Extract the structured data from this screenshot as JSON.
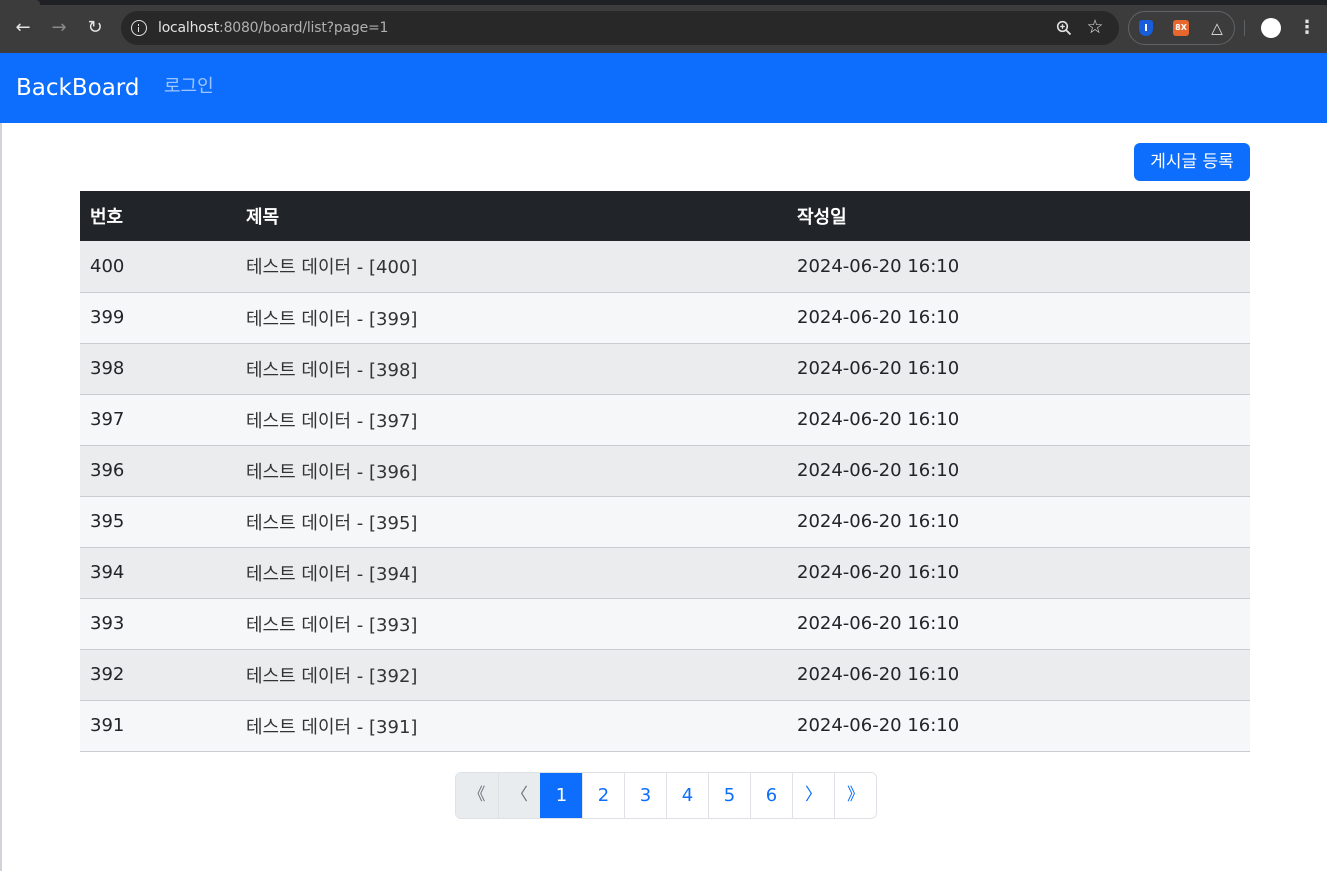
{
  "browser": {
    "url_host": "localhost",
    "url_path": ":8080/board/list?page=1",
    "ext_badge": "8X"
  },
  "navbar": {
    "brand": "BackBoard",
    "login": "로그인"
  },
  "actions": {
    "register_label": "게시글 등록"
  },
  "table": {
    "headers": {
      "num": "번호",
      "title": "제목",
      "date": "작성일"
    },
    "rows": [
      {
        "num": "400",
        "title": "테스트 데이터 - [400]",
        "date": "2024-06-20 16:10"
      },
      {
        "num": "399",
        "title": "테스트 데이터 - [399]",
        "date": "2024-06-20 16:10"
      },
      {
        "num": "398",
        "title": "테스트 데이터 - [398]",
        "date": "2024-06-20 16:10"
      },
      {
        "num": "397",
        "title": "테스트 데이터 - [397]",
        "date": "2024-06-20 16:10"
      },
      {
        "num": "396",
        "title": "테스트 데이터 - [396]",
        "date": "2024-06-20 16:10"
      },
      {
        "num": "395",
        "title": "테스트 데이터 - [395]",
        "date": "2024-06-20 16:10"
      },
      {
        "num": "394",
        "title": "테스트 데이터 - [394]",
        "date": "2024-06-20 16:10"
      },
      {
        "num": "393",
        "title": "테스트 데이터 - [393]",
        "date": "2024-06-20 16:10"
      },
      {
        "num": "392",
        "title": "테스트 데이터 - [392]",
        "date": "2024-06-20 16:10"
      },
      {
        "num": "391",
        "title": "테스트 데이터 - [391]",
        "date": "2024-06-20 16:10"
      }
    ]
  },
  "pagination": {
    "first": "《",
    "prev": "〈",
    "pages": [
      "1",
      "2",
      "3",
      "4",
      "5",
      "6"
    ],
    "active_page": "1",
    "next": "〉",
    "last": "》"
  },
  "colors": {
    "primary": "#0d6efd",
    "table_header": "#212529"
  }
}
